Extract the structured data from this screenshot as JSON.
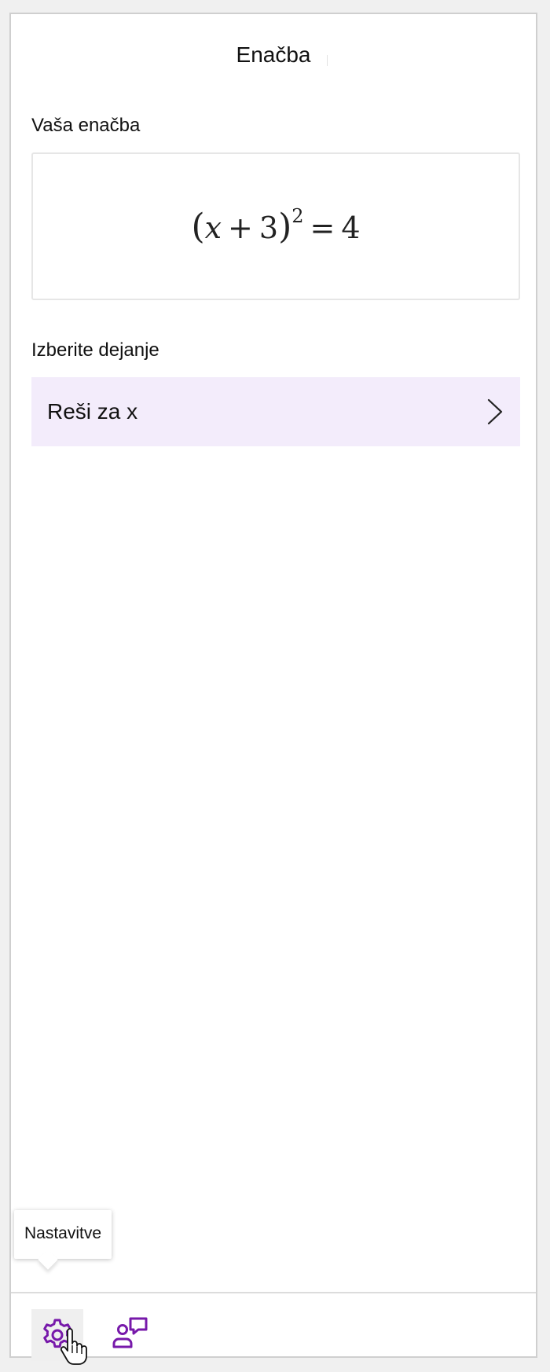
{
  "panel": {
    "title": "Enačba"
  },
  "equation_section": {
    "label": "Vaša enačba",
    "equation": {
      "lparen": "(",
      "var": "x",
      "plus": "+",
      "three": "3",
      "rparen": ")",
      "exponent": "2",
      "equals": "=",
      "rhs": "4"
    }
  },
  "action_section": {
    "label": "Izberite dejanje",
    "actions": [
      {
        "label": "Reši za x",
        "icon": "chevron-right-icon"
      }
    ]
  },
  "bottom_bar": {
    "settings": {
      "icon": "gear-icon",
      "tooltip": "Nastavitve"
    },
    "feedback": {
      "icon": "feedback-icon"
    }
  },
  "colors": {
    "accent": "#7719aa",
    "action_bg": "#f3ecfb",
    "panel_border": "#cfcfcf"
  }
}
